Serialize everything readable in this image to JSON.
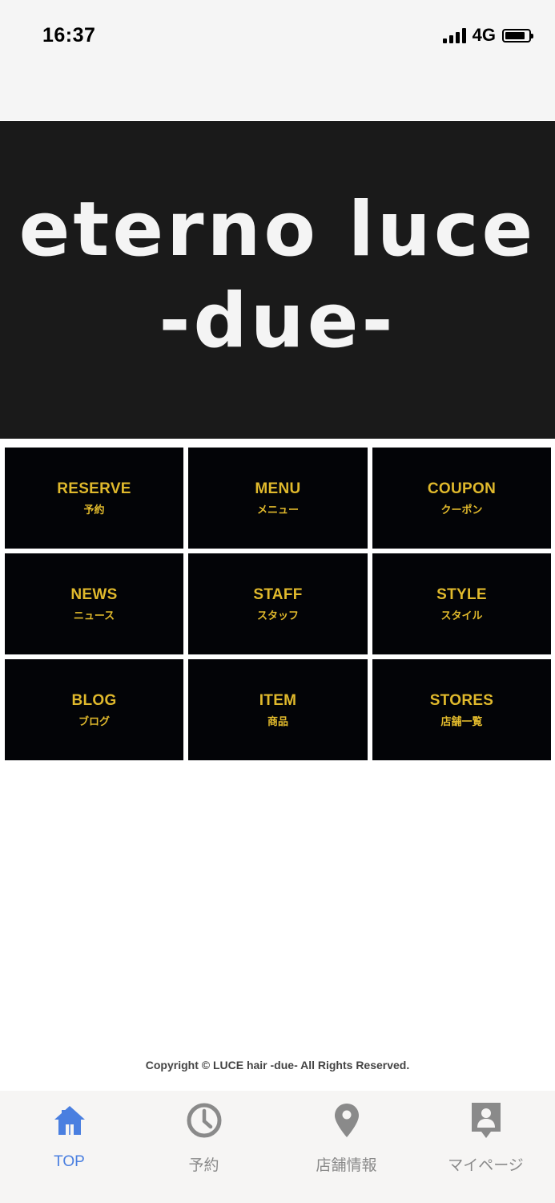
{
  "status": {
    "time": "16:37",
    "network": "4G"
  },
  "banner": {
    "line1": "eterno luce",
    "line2": "-due-"
  },
  "menu": [
    {
      "en": "RESERVE",
      "ja": "予約"
    },
    {
      "en": "MENU",
      "ja": "メニュー"
    },
    {
      "en": "COUPON",
      "ja": "クーポン"
    },
    {
      "en": "NEWS",
      "ja": "ニュース"
    },
    {
      "en": "STAFF",
      "ja": "スタッフ"
    },
    {
      "en": "STYLE",
      "ja": "スタイル"
    },
    {
      "en": "BLOG",
      "ja": "ブログ"
    },
    {
      "en": "ITEM",
      "ja": "商品"
    },
    {
      "en": "STORES",
      "ja": "店舗一覧"
    }
  ],
  "footer": {
    "copyright": "Copyright © LUCE hair -due- All Rights Reserved."
  },
  "tabs": [
    {
      "label": "TOP",
      "icon": "home-icon",
      "active": true
    },
    {
      "label": "予約",
      "icon": "clock-icon",
      "active": false
    },
    {
      "label": "店舗情報",
      "icon": "location-pin-icon",
      "active": false
    },
    {
      "label": "マイページ",
      "icon": "profile-icon",
      "active": false
    }
  ],
  "colors": {
    "accent": "#4a7fe0",
    "tile_text": "#e0b92c",
    "tile_bg": "#030407",
    "banner_bg": "#1a1a1a"
  }
}
